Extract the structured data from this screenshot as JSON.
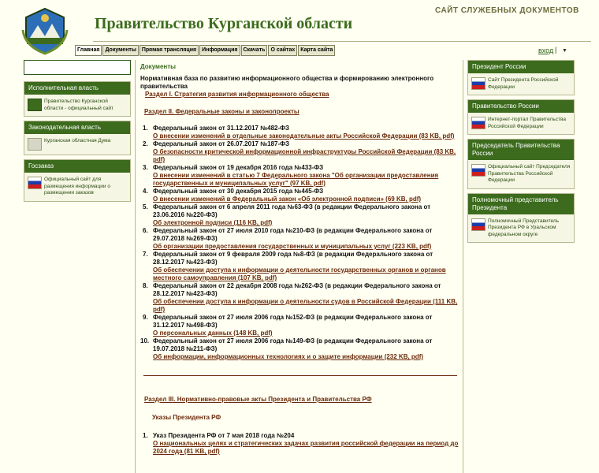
{
  "header": {
    "title": "Правительство Курганской области",
    "subtitle": "САЙТ СЛУЖЕБНЫХ ДОКУМЕНТОВ",
    "login": "вход",
    "login_sep": "|",
    "login_drop": "▼"
  },
  "nav": {
    "tabs": [
      "Главная",
      "Документы",
      "Прямая трансляция",
      "Информация",
      "Скачать",
      "О сайтах",
      "Карта сайта"
    ]
  },
  "left": {
    "blocks": [
      {
        "title": "Исполнительная власть",
        "item": "Правительство Курганской области - официальный сайт"
      },
      {
        "title": "Законодательная власть",
        "item": "Курганская областная Дума"
      },
      {
        "title": "Госзаказ",
        "item": "Официальный сайт для размещения информации о размещении заказов"
      }
    ]
  },
  "right": {
    "blocks": [
      {
        "title": "Президент России",
        "item": "Сайт Президента Российской Федерации"
      },
      {
        "title": "Правительство России",
        "item": "Интернет-портал Правительства Российской Федерации"
      },
      {
        "title": "Председатель Правительства России",
        "item": "Официальный сайт Председателя Правительства Российской Федерации"
      },
      {
        "title": "Полномочный представитель Президента",
        "item": "Полномочный Представитель Президента РФ в Уральском федеральном округе"
      }
    ]
  },
  "main": {
    "title": "Документы",
    "heading": "Нормативная база по развитию информационного общества и формированию электронного правительства",
    "section1": "Раздел I. Стратегия развития информационного общества",
    "section2": "Раздел II. Федеральные законы и законопроекты",
    "laws": [
      {
        "num": "1.",
        "title": "Федеральный закон от 31.12.2017 №482-ФЗ",
        "link": "О внесении изменений в отдельные законодательные акты Российской Федерации (83 KB, pdf)"
      },
      {
        "num": "2.",
        "title": "Федеральный закон от 26.07.2017 №187-ФЗ",
        "link": "О безопасности критической информационной инфраструктуры Российской Федерации (83 KB, pdf)"
      },
      {
        "num": "3.",
        "title": "Федеральный закон от 19 декабря 2016 года №433-ФЗ",
        "link": "О внесении изменений в статью 7 Федерального закона \"Об организации предоставления государственных и муниципальных услуг\" (97 KB, pdf)"
      },
      {
        "num": "4.",
        "title": "Федеральный закон от 30 декабря 2015 года №445-ФЗ",
        "link": "О внесении изменений в Федеральный закон «Об электронной подписи» (69 KB, pdf)"
      },
      {
        "num": "5.",
        "title": "Федеральный закон от 6 апреля 2011 года №63-ФЗ (в редакции Федерального закона от 23.06.2016 №220-ФЗ)",
        "link": "Об электронной подписи (116 KB, pdf)"
      },
      {
        "num": "6.",
        "title": "Федеральный закон от 27 июля 2010 года №210-ФЗ (в редакции Федерального закона от 29.07.2018 №269-ФЗ)",
        "link": "Об организации предоставления государственных и муниципальных услуг (223 KB, pdf)"
      },
      {
        "num": "7.",
        "title": "Федеральный закон от 9 февраля 2009 года №8-ФЗ (в редакции Федерального закона от 28.12.2017 №423-ФЗ)",
        "link": "Об обеспечении доступа к информации о деятельности государственных органов и органов местного самоуправления (107 KB, pdf)"
      },
      {
        "num": "8.",
        "title": "Федеральный закон от 22 декабря 2008 года №262-ФЗ (в редакции Федерального закона от 28.12.2017 №423-ФЗ)",
        "link": "Об обеспечении доступа к информации о деятельности судов в Российской Федерации (111 KB, pdf)"
      },
      {
        "num": "9.",
        "title": "Федеральный закон от 27 июля 2006 года №152-ФЗ (в редакции Федерального закона от 31.12.2017 №498-ФЗ)",
        "link": "О персональных данных (148 KB, pdf)"
      },
      {
        "num": "10.",
        "title": "Федеральный закон от 27 июля 2006 года №149-ФЗ (в редакции Федерального закона от 19.07.2018 №211-ФЗ)",
        "link": "Об информации, информационных технологиях и о защите информации (232 KB, pdf)"
      }
    ],
    "section3": "Раздел III. Нормативно-правовые акты Президента и Правительства РФ",
    "subhead": "Указы Президента РФ",
    "decrees": [
      {
        "num": "1.",
        "title": "Указ Президента РФ от 7 мая 2018 года №204",
        "link": "О национальных целях и стратегических задачах развития российской федерации на период до 2024 года (81 KB, pdf)"
      }
    ]
  }
}
